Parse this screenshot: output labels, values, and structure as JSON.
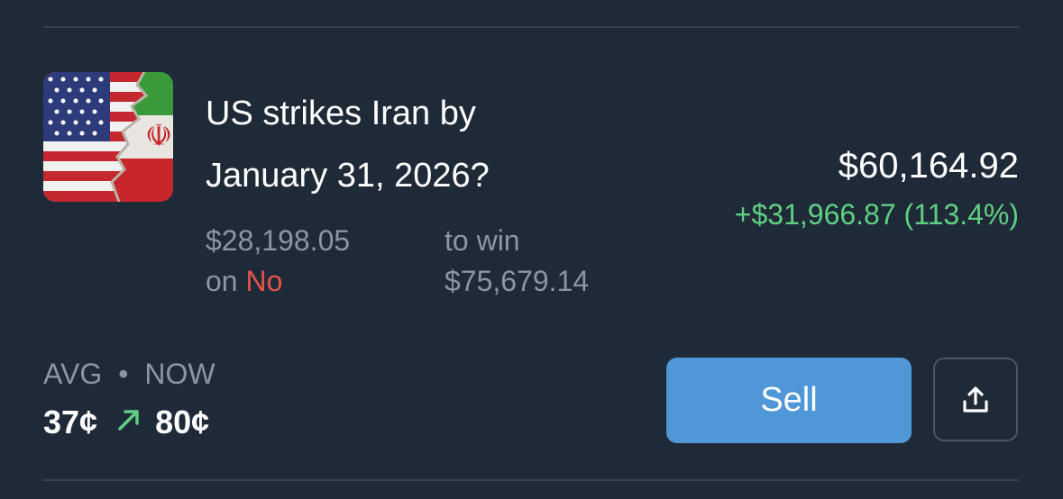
{
  "market": {
    "title_line1": "US strikes Iran by",
    "title_line2": "January 31, 2026?",
    "thumbnail_icon": "us-iran-flags-icon"
  },
  "position": {
    "stake": "$28,198.05",
    "on_label": "on",
    "side": "No",
    "to_win_label": "to win",
    "payout": "$75,679.14",
    "current_value": "$60,164.92",
    "pnl": "+$31,966.87 (113.4%)"
  },
  "prices": {
    "avg_label": "AVG",
    "separator": "•",
    "now_label": "NOW",
    "avg": "37¢",
    "now": "80¢",
    "arrow_icon": "arrow-up-right-icon"
  },
  "actions": {
    "sell_label": "Sell",
    "share_icon": "share-icon"
  },
  "colors": {
    "background": "#1f2a38",
    "positive": "#5fcf82",
    "negative": "#e5524d",
    "accent": "#4f97d6",
    "muted": "#8a95a6"
  }
}
